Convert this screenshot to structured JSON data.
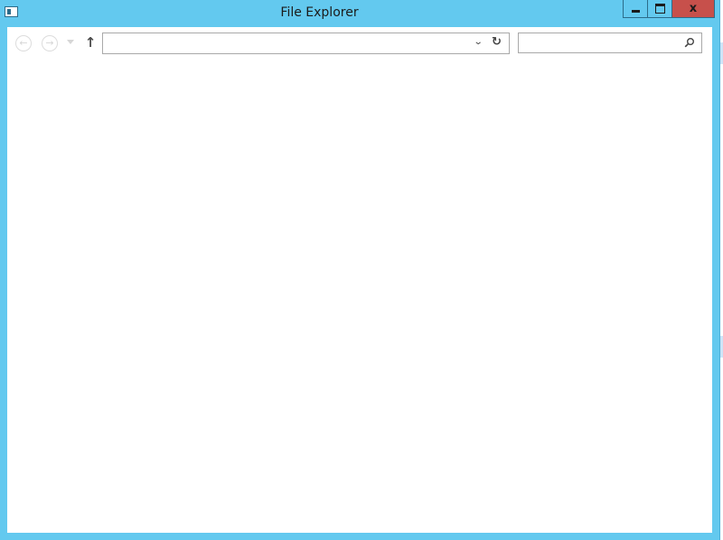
{
  "window": {
    "title": "File Explorer",
    "close_glyph": "x"
  },
  "toolbar": {
    "back_icon": "back-arrow-icon",
    "forward_icon": "forward-arrow-icon",
    "up_icon": "up-arrow-icon",
    "up_glyph": "↑",
    "back_glyph": "←",
    "forward_glyph": "→"
  },
  "address": {
    "value": "",
    "placeholder": "",
    "chevron_glyph": "⌄",
    "refresh_glyph": "↻"
  },
  "search": {
    "value": "",
    "placeholder": ""
  },
  "colors": {
    "frame": "#63c9ef",
    "close_button": "#c7504b",
    "client_bg": "#ffffff"
  }
}
